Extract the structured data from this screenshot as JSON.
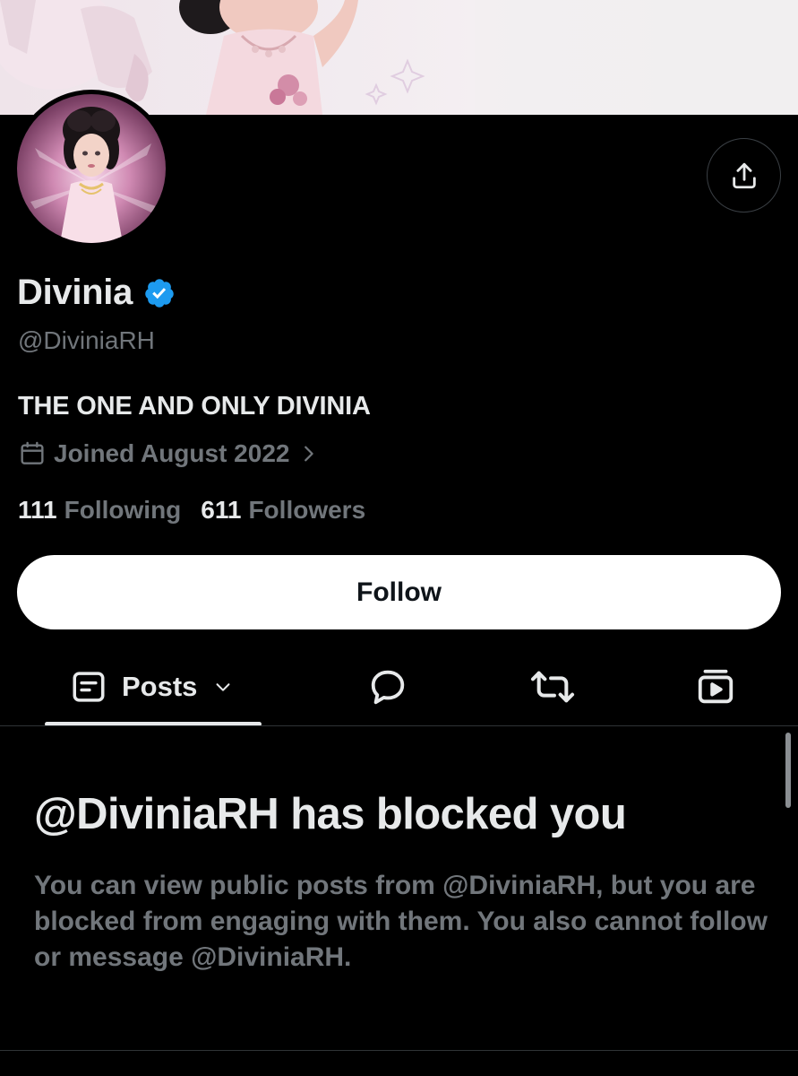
{
  "profile": {
    "display_name": "Divinia",
    "handle": "@DiviniaRH",
    "bio": "THE ONE AND ONLY DIVINIA",
    "joined": "Joined August 2022",
    "following_count": "111",
    "following_label": "Following",
    "followers_count": "611",
    "followers_label": "Followers",
    "verified": true
  },
  "actions": {
    "follow_label": "Follow",
    "share_icon": "share-upload-icon"
  },
  "tabs": [
    {
      "label": "Posts",
      "icon": "posts-icon",
      "selected": true
    },
    {
      "label": "",
      "icon": "replies-bubble-icon"
    },
    {
      "label": "",
      "icon": "repost-icon"
    },
    {
      "label": "",
      "icon": "media-video-icon"
    }
  ],
  "blocked_notice": {
    "title": "@DiviniaRH has blocked you",
    "body": "You can view public posts from @DiviniaRH, but you are blocked from engaging with them. You also cannot follow or message @DiviniaRH."
  },
  "colors": {
    "background": "#000000",
    "primary_text": "#e7e9ea",
    "secondary_text": "#71767b",
    "verified_blue": "#1d9bf0",
    "divider": "#2f3336"
  }
}
